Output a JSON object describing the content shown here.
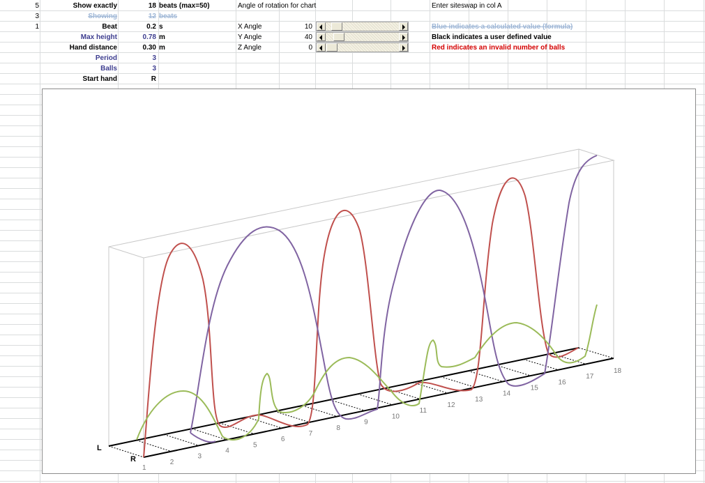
{
  "sheet": {
    "colA": [
      "5",
      "3",
      "1"
    ],
    "rows": [
      {
        "label": "Show exactly",
        "value": "18",
        "unit": "beats (max=50)"
      },
      {
        "label": "Showing",
        "value": "12",
        "unit": "beats"
      },
      {
        "label": "Beat",
        "value": "0.2",
        "unit": "s"
      },
      {
        "label": "Max height",
        "value": "0.78",
        "unit": "m"
      },
      {
        "label": "Hand distance",
        "value": "0.30",
        "unit": "m"
      },
      {
        "label": "Period",
        "value": "3",
        "unit": ""
      },
      {
        "label": "Balls",
        "value": "3",
        "unit": ""
      },
      {
        "label": "Start hand",
        "value": "R",
        "unit": ""
      }
    ],
    "rotation": {
      "title": "Angle of rotation for chart",
      "angles": [
        {
          "label": "X Angle",
          "value": "10",
          "fraction": 0.08
        },
        {
          "label": "Y Angle",
          "value": "40",
          "fraction": 0.11
        },
        {
          "label": "Z Angle",
          "value": "0",
          "fraction": 0.0
        }
      ]
    },
    "notes": {
      "enter": "Enter siteswap in col A",
      "blue": "Blue indicates a calculated value (formula)",
      "black": "Black indicates a user defined value",
      "red": "Red indicates an invalid number of balls"
    }
  },
  "chart_data": {
    "type": "line",
    "title": "",
    "hand_labels": [
      "L",
      "R"
    ],
    "beats": [
      "1",
      "2",
      "3",
      "4",
      "5",
      "6",
      "7",
      "8",
      "9",
      "10",
      "11",
      "12",
      "13",
      "14",
      "15",
      "16",
      "17",
      "18"
    ],
    "series_colors": {
      "red": "#c0504d",
      "purple": "#8064a2",
      "green": "#9bbb59"
    }
  }
}
